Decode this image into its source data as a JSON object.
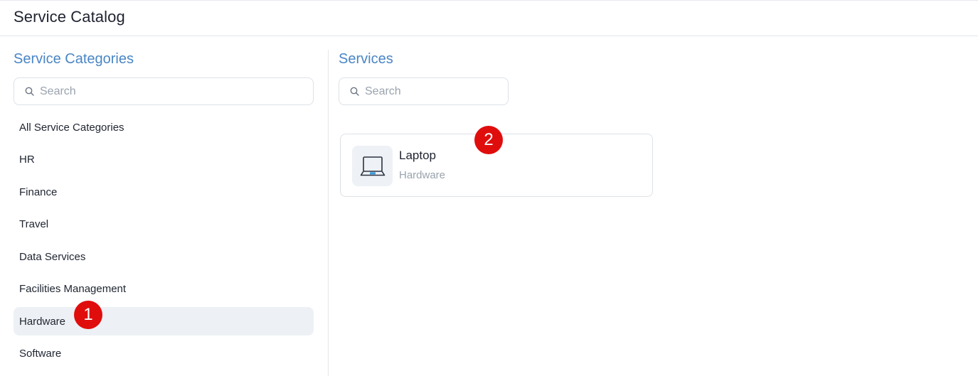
{
  "header": {
    "title": "Service Catalog"
  },
  "categories": {
    "title": "Service Categories",
    "search": {
      "placeholder": "Search",
      "value": "",
      "icon": "search-icon"
    },
    "items": [
      {
        "label": "All Service Categories",
        "selected": false
      },
      {
        "label": "HR",
        "selected": false
      },
      {
        "label": "Finance",
        "selected": false
      },
      {
        "label": "Travel",
        "selected": false
      },
      {
        "label": "Data Services",
        "selected": false
      },
      {
        "label": "Facilities Management",
        "selected": false
      },
      {
        "label": "Hardware",
        "selected": true
      },
      {
        "label": "Software",
        "selected": false
      }
    ]
  },
  "services": {
    "title": "Services",
    "search": {
      "placeholder": "Search",
      "value": "",
      "icon": "search-icon"
    },
    "cards": [
      {
        "name": "Laptop",
        "category": "Hardware",
        "icon": "laptop-icon"
      }
    ]
  },
  "annotations": {
    "badge_1": "1",
    "badge_2": "2"
  },
  "colors": {
    "accent": "#4a86c5",
    "selected_bg": "#edf0f4",
    "badge": "#e00d0d",
    "laptop_accent": "#3b9bd8"
  }
}
